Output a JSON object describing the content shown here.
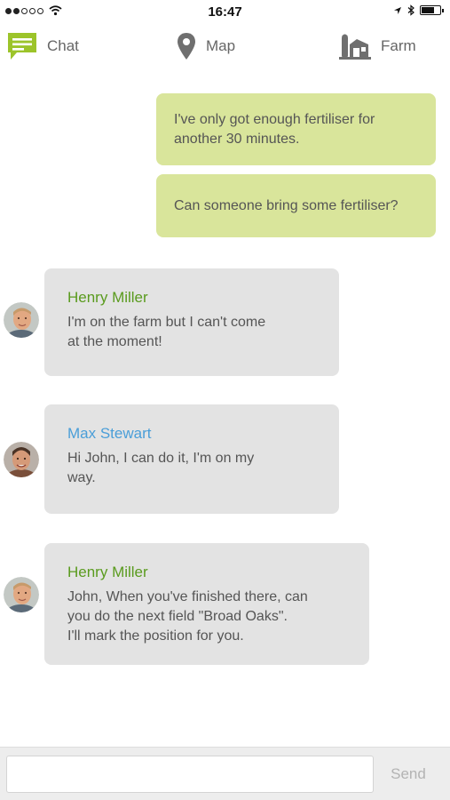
{
  "status_bar": {
    "time": "16:47"
  },
  "nav": {
    "chat_label": "Chat",
    "map_label": "Map",
    "farm_label": "Farm",
    "accent_color": "#9cc42a"
  },
  "messages": [
    {
      "direction": "outgoing",
      "lines": [
        "I've only got enough fertiliser for",
        "another 30 minutes."
      ]
    },
    {
      "direction": "outgoing",
      "lines": [
        "Can someone bring some fertiliser?"
      ]
    },
    {
      "direction": "incoming",
      "sender": "Henry Miller",
      "lines": [
        "I'm on the farm but I can't come",
        "at the moment!"
      ]
    },
    {
      "direction": "incoming",
      "sender": "Max Stewart",
      "lines": [
        "Hi John, I can do it, I'm on my",
        "way."
      ]
    },
    {
      "direction": "incoming",
      "sender": "Henry Miller",
      "lines": [
        "John, When you've finished there, can",
        "you do the next field \"Broad Oaks\".",
        "I'll mark the position for you."
      ]
    }
  ],
  "composer": {
    "value": "",
    "placeholder": "",
    "send_label": "Send"
  }
}
